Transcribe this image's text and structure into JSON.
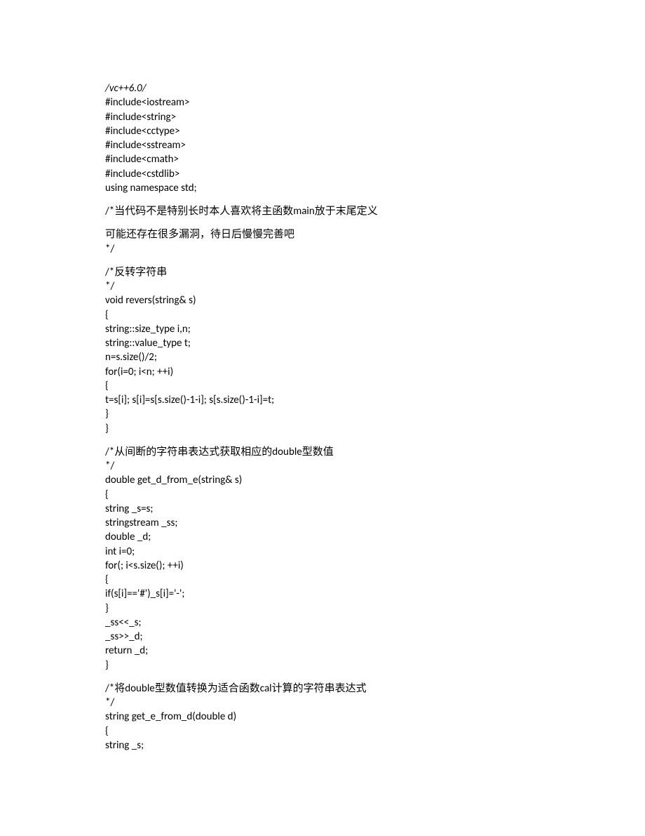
{
  "blocks": [
    {
      "lines": [
        {
          "text": "/vc++6.0/",
          "italic": true
        },
        {
          "text": "#include<iostream>"
        },
        {
          "text": "#include<string>"
        },
        {
          "text": "#include<cctype>"
        },
        {
          "text": "#include<sstream>"
        },
        {
          "text": "#include<cmath>"
        },
        {
          "text": "#include<cstdlib>"
        },
        {
          "text": "using namespace std;"
        }
      ]
    },
    {
      "lines": [
        {
          "text": "/*当代码不是特别长时本人喜欢将主函数main放于末尾定义"
        }
      ]
    },
    {
      "lines": [
        {
          "text": "可能还存在很多漏洞，待日后慢慢完善吧"
        },
        {
          "text": "*/"
        }
      ]
    },
    {
      "lines": [
        {
          "text": "/*反转字符串"
        },
        {
          "text": "*/"
        },
        {
          "text": "void revers(string& s)"
        },
        {
          "text": "{"
        },
        {
          "text": "string::size_type i,n;"
        },
        {
          "text": "string::value_type t;"
        },
        {
          "text": "n=s.size()/2;"
        },
        {
          "text": "for(i=0; i<n; ++i)"
        },
        {
          "text": "{"
        },
        {
          "text": "t=s[i]; s[i]=s[s.size()-1-i]; s[s.size()-1-i]=t;"
        },
        {
          "text": "}"
        },
        {
          "text": "}"
        }
      ]
    },
    {
      "lines": [
        {
          "text": "/*从间断的字符串表达式获取相应的double型数值"
        },
        {
          "text": "*/"
        },
        {
          "text": "double get_d_from_e(string& s)"
        },
        {
          "text": "{"
        },
        {
          "text": "string _s=s;"
        },
        {
          "text": "stringstream _ss;"
        },
        {
          "text": "double _d;"
        },
        {
          "text": "int i=0;"
        },
        {
          "text": "for(; i<s.size(); ++i)"
        },
        {
          "text": "{"
        },
        {
          "text": "if(s[i]=='#')_s[i]='-';"
        },
        {
          "text": "}"
        },
        {
          "text": "_ss<<_s;"
        },
        {
          "text": "_ss>>_d;"
        },
        {
          "text": "return _d;"
        },
        {
          "text": "}"
        }
      ]
    },
    {
      "lines": [
        {
          "text": "/*将double型数值转换为适合函数cal计算的字符串表达式"
        },
        {
          "text": "*/"
        },
        {
          "text": "string get_e_from_d(double d)"
        },
        {
          "text": "{"
        },
        {
          "text": "string _s;"
        }
      ]
    }
  ]
}
